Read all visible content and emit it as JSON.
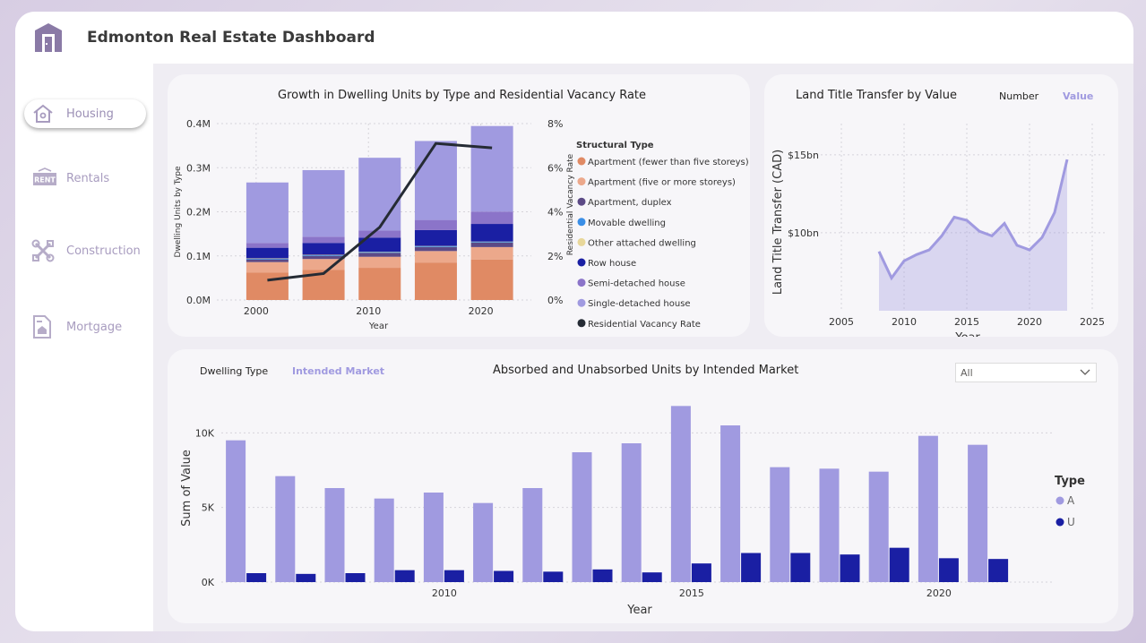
{
  "app": {
    "title": "Edmonton Real Estate Dashboard"
  },
  "nav": {
    "items": [
      {
        "label": "Housing",
        "icon": "house-icon",
        "active": true
      },
      {
        "label": "Rentals",
        "icon": "rent-sign-icon",
        "active": false
      },
      {
        "label": "Construction",
        "icon": "tools-icon",
        "active": false
      },
      {
        "label": "Mortgage",
        "icon": "document-house-icon",
        "active": false
      }
    ]
  },
  "colors": {
    "accent": "#a09ae0",
    "dark_blue": "#1a1fa3",
    "orange": "#e08a64",
    "light_orange": "#eca88b",
    "line": "#252b34"
  },
  "dwelling_chart": {
    "title": "Growth in Dwelling Units by Type and Residential Vacancy Rate",
    "legend_title": "Structural Type",
    "xlabel": "Year",
    "ylabel": "Dwelling Units by Type",
    "y2label": "Residential Vacancy Rate",
    "yticks": [
      "0.0M",
      "0.1M",
      "0.2M",
      "0.3M",
      "0.4M"
    ],
    "y2ticks": [
      "0%",
      "2%",
      "4%",
      "6%",
      "8%"
    ],
    "xticks": [
      "2000",
      "2010",
      "2020"
    ]
  },
  "land_chart": {
    "title": "Land Title Transfer by Value",
    "toggle_number": "Number",
    "toggle_value": "Value",
    "xlabel": "Year",
    "ylabel": "Land Title Transfer (CAD)",
    "yticks": [
      "$10bn",
      "$15bn"
    ],
    "xticks": [
      "2005",
      "2010",
      "2015",
      "2020",
      "2025"
    ]
  },
  "absorbed_chart": {
    "title": "Absorbed and Unabsorbed Units by Intended Market",
    "toggle_dwelling": "Dwelling Type",
    "toggle_market": "Intended Market",
    "filter_value": "All",
    "xlabel": "Year",
    "ylabel": "Sum of Value",
    "legend_title": "Type",
    "yticks": [
      "0K",
      "5K",
      "10K"
    ],
    "xticks": [
      "2010",
      "2015",
      "2020"
    ]
  },
  "chart_data": [
    {
      "type": "bar",
      "stacked": true,
      "title": "Growth in Dwelling Units by Type and Residential Vacancy Rate",
      "xlabel": "Year",
      "ylabel": "Dwelling Units by Type",
      "y2label": "Residential Vacancy Rate",
      "categories": [
        2001,
        2006,
        2011,
        2016,
        2021
      ],
      "ylim": [
        0,
        400000
      ],
      "y2lim": [
        0,
        8
      ],
      "series": [
        {
          "name": "Apartment (fewer than five storeys)",
          "color": "#e08a64",
          "values": [
            62000,
            68000,
            73000,
            85000,
            92000
          ]
        },
        {
          "name": "Apartment (five or more storeys)",
          "color": "#eca88b",
          "values": [
            24000,
            25000,
            25000,
            26000,
            28000
          ]
        },
        {
          "name": "Apartment, duplex",
          "color": "#5c4a86",
          "values": [
            6000,
            7000,
            9000,
            9000,
            10000
          ]
        },
        {
          "name": "Movable dwelling",
          "color": "#3a8ee6",
          "values": [
            2000,
            2000,
            2000,
            2000,
            2000
          ]
        },
        {
          "name": "Other attached dwelling",
          "color": "#e8d79a",
          "values": [
            500,
            500,
            500,
            500,
            500
          ]
        },
        {
          "name": "Row house",
          "color": "#1a1fa3",
          "values": [
            24000,
            27000,
            32000,
            36000,
            40000
          ]
        },
        {
          "name": "Semi-detached house",
          "color": "#8b74c9",
          "values": [
            11000,
            14000,
            16000,
            23000,
            28000
          ]
        },
        {
          "name": "Single-detached house",
          "color": "#a09ae0",
          "values": [
            137000,
            151000,
            165000,
            179000,
            194000
          ]
        }
      ],
      "line": {
        "name": "Residential Vacancy Rate",
        "color": "#252b34",
        "x": [
          2001,
          2006,
          2011,
          2016,
          2021
        ],
        "values": [
          0.9,
          1.2,
          3.3,
          7.1,
          6.9
        ]
      },
      "xticks": [
        2000,
        2010,
        2020
      ],
      "legend": "right"
    },
    {
      "type": "area",
      "title": "Land Title Transfer by Value",
      "xlabel": "Year",
      "ylabel": "Land Title Transfer (CAD)",
      "x": [
        2008,
        2009,
        2010,
        2011,
        2012,
        2013,
        2014,
        2015,
        2016,
        2017,
        2018,
        2019,
        2020,
        2021,
        2022,
        2023
      ],
      "values": [
        8.8,
        7.1,
        8.2,
        8.6,
        8.9,
        9.8,
        11.0,
        10.8,
        10.1,
        9.8,
        10.6,
        9.2,
        8.9,
        9.7,
        11.3,
        14.7
      ],
      "unit": "bn CAD",
      "xlim": [
        2003,
        2026
      ],
      "ylim": [
        5,
        17
      ],
      "yticks": [
        10,
        15
      ],
      "xticks": [
        2005,
        2010,
        2015,
        2020,
        2025
      ],
      "color": "#a09ae0"
    },
    {
      "type": "bar",
      "title": "Absorbed and Unabsorbed Units by Intended Market",
      "xlabel": "Year",
      "ylabel": "Sum of Value",
      "categories": [
        2007,
        2008,
        2009,
        2010,
        2011,
        2012,
        2013,
        2014,
        2015,
        2016,
        2017,
        2018,
        2019,
        2020,
        2021
      ],
      "series": [
        {
          "name": "A",
          "color": "#a09ae0",
          "values": [
            9500,
            7100,
            6300,
            5600,
            6000,
            5300,
            6300,
            8700,
            9300,
            11800,
            10500,
            7700,
            7600,
            7400,
            9800,
            9200
          ]
        },
        {
          "name": "U",
          "color": "#1a1fa3",
          "values": [
            600,
            550,
            600,
            800,
            800,
            750,
            700,
            850,
            650,
            1250,
            1950,
            1950,
            1850,
            2300,
            1600,
            1550
          ]
        }
      ],
      "x_numeric": [
        2006,
        2007,
        2008,
        2009,
        2010,
        2011,
        2012,
        2013,
        2014,
        2015,
        2016,
        2017,
        2018,
        2019,
        2020,
        2021
      ],
      "ylim": [
        0,
        12000
      ],
      "yticks": [
        0,
        5000,
        10000
      ],
      "xticks": [
        2010,
        2015,
        2020
      ],
      "legend": "right"
    }
  ]
}
